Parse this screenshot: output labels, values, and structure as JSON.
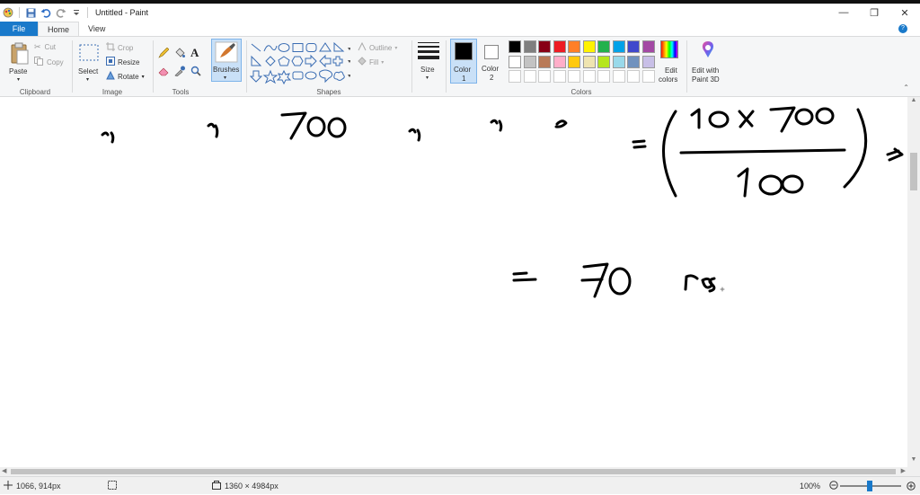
{
  "window": {
    "title": "Untitled - Paint",
    "controls": [
      "—",
      "❐",
      "✕"
    ]
  },
  "tabs": [
    {
      "label": "File"
    },
    {
      "label": "Home"
    },
    {
      "label": "View"
    }
  ],
  "ribbon": {
    "clipboard": {
      "paste": "Paste",
      "cut": "Cut",
      "copy": "Copy",
      "label": "Clipboard"
    },
    "image": {
      "select": "Select",
      "crop": "Crop",
      "resize": "Resize",
      "rotate": "Rotate",
      "label": "Image"
    },
    "tools": {
      "label": "Tools"
    },
    "brushes": {
      "label": "Brushes"
    },
    "shapes": {
      "outline": "Outline",
      "fill": "Fill",
      "label": "Shapes"
    },
    "size": {
      "label": "Size"
    },
    "color1": {
      "label1": "Color",
      "label2": "1"
    },
    "color2": {
      "label1": "Color",
      "label2": "2"
    },
    "colors": {
      "label": "Colors"
    },
    "edit_colors": {
      "label1": "Edit",
      "label2": "colors"
    },
    "paint3d": {
      "label1": "Edit with",
      "label2": "Paint 3D"
    }
  },
  "palette": {
    "row1": [
      "#000000",
      "#7f7f7f",
      "#880015",
      "#ed1c24",
      "#ff7f27",
      "#fff200",
      "#22b14c",
      "#00a2e8",
      "#3f48cc",
      "#a349a4"
    ],
    "row2": [
      "#ffffff",
      "#c3c3c3",
      "#b97a57",
      "#ffaec9",
      "#ffc90e",
      "#efe4b0",
      "#b5e61d",
      "#99d9ea",
      "#7092be",
      "#c8bfe7"
    ],
    "color1": "#000000",
    "color2": "#ffffff"
  },
  "canvas": {
    "handwriting": {
      "line1_value": "700",
      "numerator": "10 x 700",
      "denominator": "100",
      "result": "70",
      "unit": "rs."
    }
  },
  "status": {
    "cursor_pos": "1066, 914px",
    "selection_size": "",
    "image_size": "1360 × 4984px",
    "zoom": "100%"
  }
}
